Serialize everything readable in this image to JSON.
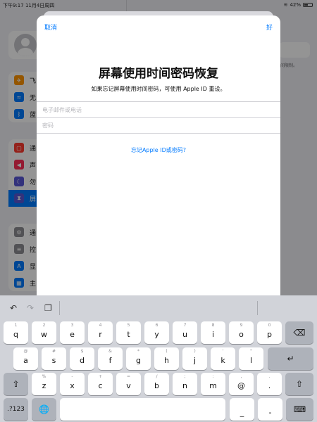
{
  "status_bar": {
    "time_date": "下午9:17   11月4日周四",
    "battery": "42%"
  },
  "background": {
    "sidebar_items_group2": [
      "飞",
      "无",
      "蓝"
    ],
    "sidebar_items_group3": [
      "通",
      "声",
      "勿",
      "屏"
    ],
    "sidebar_items_group4": [
      "通",
      "控",
      "显",
      "主"
    ],
    "right_note": "间限制。",
    "colors": {
      "airplane": "#ff9500",
      "wifi": "#007aff",
      "bluetooth": "#007aff",
      "notifications": "#ff3b30",
      "sounds": "#ff2d55",
      "focus": "#5856d6",
      "screen_time": "#5856d6",
      "general": "#8e8e93",
      "control_center": "#8e8e93",
      "display": "#007aff",
      "home": "#007aff"
    }
  },
  "modal": {
    "cancel": "取消",
    "done": "好",
    "title": "屏幕使用时间密码恢复",
    "subtitle": "如果忘记屏幕使用时间密码，可使用 Apple ID 重设。",
    "email_placeholder": "电子邮件或电话",
    "password_placeholder": "密码",
    "forgot_link": "忘记Apple ID或密码?"
  },
  "keyboard": {
    "row1": [
      {
        "main": "q",
        "sub": "1"
      },
      {
        "main": "w",
        "sub": "2"
      },
      {
        "main": "e",
        "sub": "3"
      },
      {
        "main": "r",
        "sub": "4"
      },
      {
        "main": "t",
        "sub": "5"
      },
      {
        "main": "y",
        "sub": "6"
      },
      {
        "main": "u",
        "sub": "7"
      },
      {
        "main": "i",
        "sub": "8"
      },
      {
        "main": "o",
        "sub": "9"
      },
      {
        "main": "p",
        "sub": "0"
      }
    ],
    "row2": [
      {
        "main": "a",
        "sub": "@"
      },
      {
        "main": "s",
        "sub": "#"
      },
      {
        "main": "d",
        "sub": "$"
      },
      {
        "main": "f",
        "sub": "&"
      },
      {
        "main": "g",
        "sub": "*"
      },
      {
        "main": "h",
        "sub": "("
      },
      {
        "main": "j",
        "sub": ")"
      },
      {
        "main": "k",
        "sub": "'"
      },
      {
        "main": "l",
        "sub": "\""
      }
    ],
    "row3": [
      {
        "main": "z",
        "sub": "%"
      },
      {
        "main": "x",
        "sub": "-"
      },
      {
        "main": "c",
        "sub": "+"
      },
      {
        "main": "v",
        "sub": "="
      },
      {
        "main": "b",
        "sub": "/"
      },
      {
        "main": "n",
        "sub": ";"
      },
      {
        "main": "m",
        "sub": ":"
      },
      {
        "main": "@",
        "sub": ","
      },
      {
        "main": ".",
        "sub": "."
      }
    ],
    "numbers_key": ".?123",
    "underscore_key": "_",
    "dash_key": "-"
  }
}
